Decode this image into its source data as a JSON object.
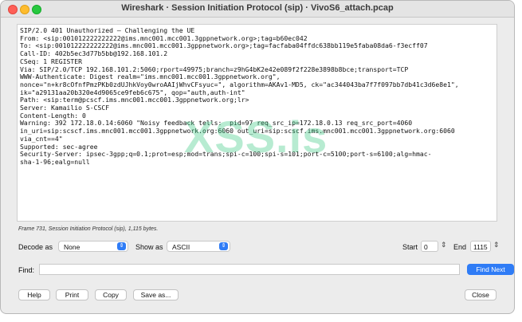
{
  "window": {
    "title": "Wireshark · Session Initiation Protocol (sip) · VivoS6_attach.pcap"
  },
  "packet_text": {
    "lines": [
      "SIP/2.0 401 Unauthorized – Challenging the UE",
      "From: <sip:001012222222222@ims.mnc001.mcc001.3gppnetwork.org>;tag=b60ec042",
      "To: <sip:001012222222222@ims.mnc001.mcc001.3gppnetwork.org>;tag=facfaba04ffdc638bb119e5faba08da6-f3ecff07",
      "Call-ID: 402b5ec3d77b5bb@192.168.101.2",
      "CSeq: 1 REGISTER",
      "Via: SIP/2.0/TCP 192.168.101.2:5060;rport=49975;branch=z9hG4bK2e42e089f2f228e3898b8bce;transport=TCP",
      "WWW-Authenticate: Digest realm=\"ims.mnc001.mcc001.3gppnetwork.org\",",
      "nonce=\"n+kr8cOfnfPmzPKb0zdUJhkVoy0wroAAIjWhvCFsyuc=\", algorithm=AKAv1-MD5, ck=\"ac344043ba7f7f097bb7db41c3d6e8e1\",",
      "ik=\"a29131aa20b320e4d9065ce9feb6c675\", qop=\"auth,auth-int\"",
      "Path: <sip:term@pcscf.ims.mnc001.mcc001.3gppnetwork.org;lr>",
      "Server: Kamailio S-CSCF",
      "Content-Length: 0",
      "Warning: 392 172.18.0.14:6060 \"Noisy feedback tells:  pid=97 req_src_ip=172.18.0.13 req_src_port=4060",
      "in_uri=sip:scscf.ims.mnc001.mcc001.3gppnetwork.org:6060 out_uri=sip:scscf.ims.mnc001.mcc001.3gppnetwork.org:6060",
      "via_cnt==4\"",
      "Supported: sec-agree",
      "Security-Server: ipsec-3gpp;q=0.1;prot=esp;mod=trans;spi-c=100;spi-s=101;port-c=5100;port-s=6100;alg=hmac-",
      "sha-1-96;ealg=null"
    ]
  },
  "watermark": "XSS.is",
  "status_text": "Frame 731, Session Initiation Protocol (sip), 1,115 bytes.",
  "controls": {
    "decode_as_label": "Decode as",
    "decode_as_value": "None",
    "show_as_label": "Show as",
    "show_as_value": "ASCII",
    "start_label": "Start",
    "start_value": "0",
    "end_label": "End",
    "end_value": "1115"
  },
  "find": {
    "label": "Find:",
    "value": "",
    "button": "Find Next"
  },
  "buttons": {
    "help": "Help",
    "print": "Print",
    "copy": "Copy",
    "save_as": "Save as...",
    "close": "Close"
  },
  "colors": {
    "accent": "#2f7cf6",
    "watermark": "#35c77e"
  }
}
